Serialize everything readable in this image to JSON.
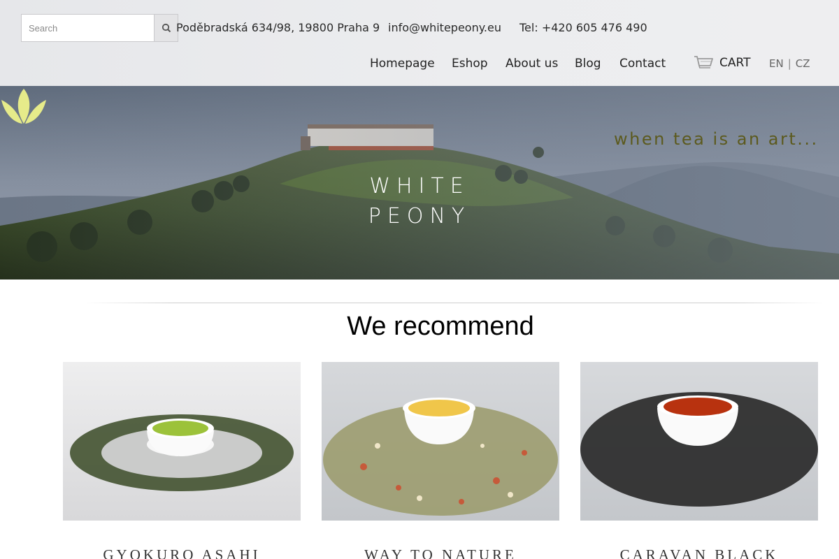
{
  "search": {
    "placeholder": "Search"
  },
  "contact": {
    "address": "Poděbradská 634/98, 19800 Praha 9",
    "email": "info@whitepeony.eu",
    "phone": "Tel: +420 605 476 490"
  },
  "nav": {
    "items": [
      "Homepage",
      "Eshop",
      "About us",
      "Blog",
      "Contact"
    ],
    "cart_label": "CART"
  },
  "lang": {
    "en": "EN",
    "separator": "|",
    "cz": "CZ"
  },
  "hero": {
    "tagline": "when tea is an art...",
    "brand_line1": "WHITE",
    "brand_line2": "PEONY"
  },
  "recommend": {
    "title": "We recommend",
    "products": [
      {
        "name": "GYOKURO ASAHI",
        "tea_color": "#9cc23a",
        "leaf_color": "#3a4a26"
      },
      {
        "name": "WAY TO NATURE",
        "tea_color": "#f0c64a",
        "leaf_color": "#9a9a6a"
      },
      {
        "name": "CARAVAN BLACK",
        "tea_color": "#b8320f",
        "leaf_color": "#2a2a2a"
      }
    ]
  },
  "colors": {
    "tagline": "#5c5a1e",
    "lotus": "#e6eb8a",
    "header_bg": "#e9eaec"
  }
}
